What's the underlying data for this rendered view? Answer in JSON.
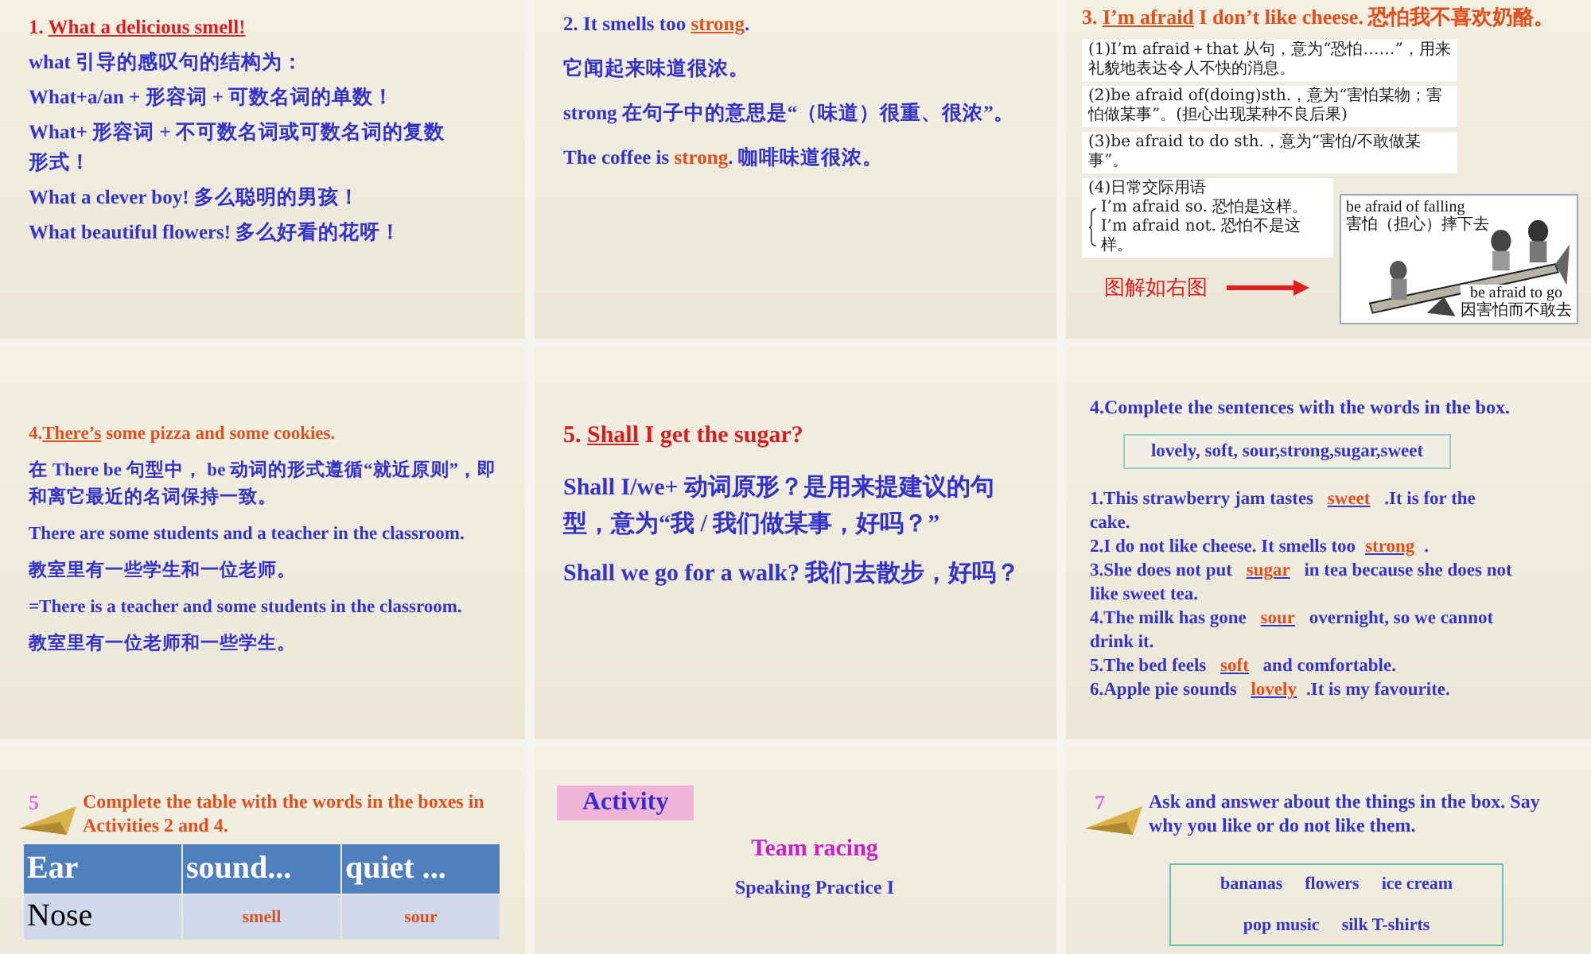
{
  "slides": [
    {
      "kind": "notes",
      "lines": [
        {
          "segments": [
            {
              "text": "1. ",
              "color": "#d42020",
              "underline": false
            },
            {
              "text": "What a delicious smell!",
              "color": "#d42020",
              "underline": true
            }
          ]
        },
        {
          "segments": [
            {
              "text": "what 引导的感叹句的结构为：",
              "color": "#3434c8",
              "underline": false
            }
          ]
        },
        {
          "segments": [
            {
              "text": "What+a/an + 形容词 + 可数名词的单数！",
              "color": "#3434c8",
              "underline": false
            }
          ]
        },
        {
          "segments": [
            {
              "text": "What+ 形容词 + 不可数名词或可数名词的复数形式！",
              "color": "#3434c8",
              "underline": false
            }
          ]
        },
        {
          "segments": [
            {
              "text": "What a clever boy! 多么聪明的男孩！",
              "color": "#3434c8",
              "underline": false
            }
          ]
        },
        {
          "segments": [
            {
              "text": "What beautiful flowers! 多么好看的花呀！",
              "color": "#3434c8",
              "underline": false
            }
          ]
        }
      ]
    },
    {
      "kind": "notes",
      "lines": [
        {
          "segments": [
            {
              "text": "2. It smells too ",
              "color": "#3434c8",
              "underline": false
            },
            {
              "text": "strong",
              "color": "#e0501c",
              "underline": true
            },
            {
              "text": ".",
              "color": "#3434c8",
              "underline": false
            }
          ]
        },
        {
          "segments": [
            {
              "text": "它闻起来味道很浓。",
              "color": "#3434c8",
              "underline": false
            }
          ]
        },
        {
          "segments": [
            {
              "text": "strong 在句子中的意思是“（味道）很重、很浓”。",
              "color": "#3434c8",
              "underline": false
            }
          ]
        },
        {
          "segments": [
            {
              "text": "The coffee is ",
              "color": "#3434c8",
              "underline": false
            },
            {
              "text": "strong",
              "color": "#e0501c",
              "underline": false
            },
            {
              "text": ".  咖啡味道很浓。",
              "color": "#3434c8",
              "underline": false
            }
          ]
        }
      ]
    },
    {
      "kind": "scan",
      "title": {
        "segments": [
          {
            "text": "3. ",
            "color": "#e0501c",
            "underline": false
          },
          {
            "text": "I’m afraid",
            "color": "#e0501c",
            "underline": true
          },
          {
            "text": " I don’t like cheese.  恐怕我不喜欢奶酪。",
            "color": "#e0501c",
            "underline": false
          }
        ]
      },
      "boxes": [
        [
          "(1)I’m afraid＋that 从句，意为“恐怕……”，用来礼貌地表达令人不快的消息。"
        ],
        [
          "(2)be afraid of(doing)sth.，意为“害怕某物；害怕做某事”。(担心出现某种不良后果)"
        ],
        [
          "(3)be afraid to do sth.，意为“害怕/不敢做某事”。"
        ]
      ],
      "phrases": {
        "heading": "(4)日常交际用语",
        "items": [
          "I’m afraid so. 恐怕是这样。",
          "I’m afraid not. 恐怕不是这样。"
        ]
      },
      "caption": "图解如右图",
      "figure": {
        "kind": "picture",
        "labels": [
          [
            "be afraid of falling",
            "害怕（担心）摔下去"
          ],
          [
            "be afraid to go",
            "因害怕而不敢去"
          ]
        ]
      }
    },
    {
      "kind": "notes",
      "lines": [
        {
          "segments": [
            {
              "text": "4.",
              "color": "#e0501c",
              "underline": false
            },
            {
              "text": "There’s",
              "color": "#e0501c",
              "underline": true
            },
            {
              "text": " some pizza and some cookies.",
              "color": "#e0501c",
              "underline": false
            }
          ]
        },
        {
          "segments": [
            {
              "text": "在 There be  句型中，  be 动词的形式遵循“就近原则”，即和离它最近的名词保持一致。",
              "color": "#3434c8",
              "underline": false
            }
          ]
        },
        {
          "segments": [
            {
              "text": "There are some students and a teacher in the classroom.",
              "color": "#3434c8",
              "underline": false
            }
          ]
        },
        {
          "segments": [
            {
              "text": "教室里有一些学生和一位老师。",
              "color": "#3434c8",
              "underline": false
            }
          ]
        },
        {
          "segments": [
            {
              "text": "=There is a teacher and some students in the classroom.",
              "color": "#3434c8",
              "underline": false
            }
          ]
        },
        {
          "segments": [
            {
              "text": "教室里有一位老师和一些学生。",
              "color": "#3434c8",
              "underline": false
            }
          ]
        }
      ]
    },
    {
      "kind": "notes",
      "lines": [
        {
          "segments": [
            {
              "text": "5. ",
              "color": "#d42020",
              "underline": false
            },
            {
              "text": "Shall",
              "color": "#d42020",
              "underline": true
            },
            {
              "text": " I get the sugar?",
              "color": "#d42020",
              "underline": false
            }
          ]
        },
        {
          "segments": [
            {
              "text": "Shall I/we+ 动词原形？是用来提建议的句型，意为“我 / 我们做某事，好吗？”",
              "color": "#3434c8",
              "underline": false
            }
          ]
        },
        {
          "segments": [
            {
              "text": "Shall we go for a walk? 我们去散步，好吗？",
              "color": "#3434c8",
              "underline": false
            }
          ]
        }
      ]
    },
    {
      "kind": "exercise",
      "heading": "4.Complete the sentences with the words in the box.",
      "wordbox": "lovely, soft, sour,strong,sugar,sweet",
      "sentences": [
        {
          "before": "1.This strawberry jam tastes ",
          "answer": "sweet",
          "after": " .It is for the cake."
        },
        {
          "before": "2.I do not like cheese. It smells too",
          "answer": "strong",
          "after": "."
        },
        {
          "before": "3.She does not put ",
          "answer": "sugar",
          "after": " in tea because she does not like sweet tea."
        },
        {
          "before": "4.The milk has gone ",
          "answer": "sour",
          "after": " overnight, so we cannot drink it."
        },
        {
          "before": "5.The bed feels ",
          "answer": "soft",
          "after": " and comfortable."
        },
        {
          "before": "6.Apple pie sounds ",
          "answer": "lovely",
          "after": ".It is my favourite."
        }
      ]
    },
    {
      "kind": "table",
      "number": "5",
      "heading": "Complete the table with the words in the boxes in Activities 2 and 4.",
      "header": [
        "Ear",
        "sound...",
        "quiet ..."
      ],
      "rows": [
        [
          "Nose",
          "smell",
          "sour"
        ]
      ]
    },
    {
      "kind": "title",
      "badge": "Activity",
      "title": "Team racing",
      "subtitle": "Speaking Practice I"
    },
    {
      "kind": "wordbox",
      "number": "7",
      "heading": "Ask and answer about the things in the box. Say why you like or do not like them.",
      "rows": [
        [
          "bananas",
          "flowers",
          "ice cream"
        ],
        [
          "pop music",
          "silk T-shirts"
        ]
      ]
    }
  ]
}
